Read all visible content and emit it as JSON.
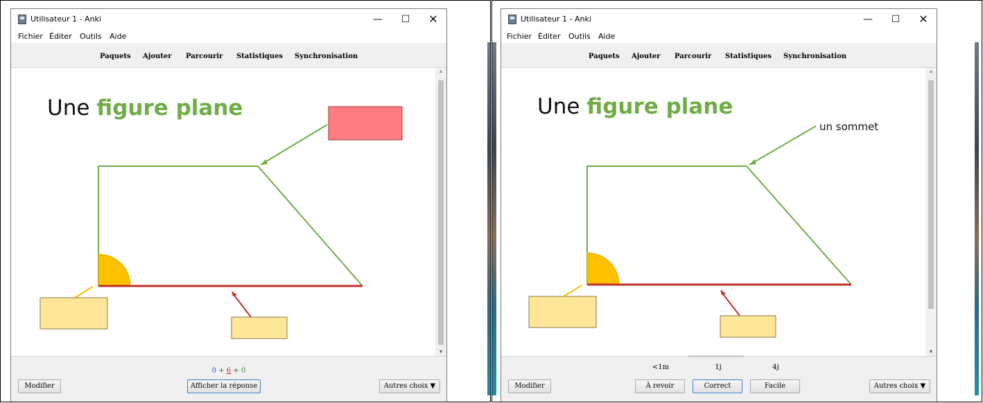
{
  "app": {
    "title": "Utilisateur 1 - Anki",
    "controls": {
      "minimize": "—",
      "maximize": "☐",
      "close": "✕"
    }
  },
  "menu": [
    "Fichier",
    "Éditer",
    "Outils",
    "Aide"
  ],
  "toolbar": [
    "Paquets",
    "Ajouter",
    "Parcourir",
    "Statistiques",
    "Synchronisation"
  ],
  "card": {
    "heading_plain": "Une ",
    "heading_accent": "figure plane",
    "accent_color": "#70ad47",
    "revealed_label": "un sommet",
    "shape_color": "#70ad47",
    "base_color": "#c0302a",
    "angle_color": "#ffc000",
    "hidden_box_color": "#ff7c80",
    "label_box_color": "#ffe699"
  },
  "front": {
    "counts": {
      "new": "0",
      "learn": "6",
      "review": "0",
      "sep": "+"
    },
    "edit_button": "Modifier",
    "show_answer_button": "Afficher la réponse",
    "more_button": "Autres choix ▼"
  },
  "back": {
    "intervals": [
      "<1m",
      "1j",
      "4j"
    ],
    "edit_button": "Modifier",
    "again_button": "À revoir",
    "good_button": "Correct",
    "easy_button": "Facile",
    "more_button": "Autres choix ▼"
  }
}
